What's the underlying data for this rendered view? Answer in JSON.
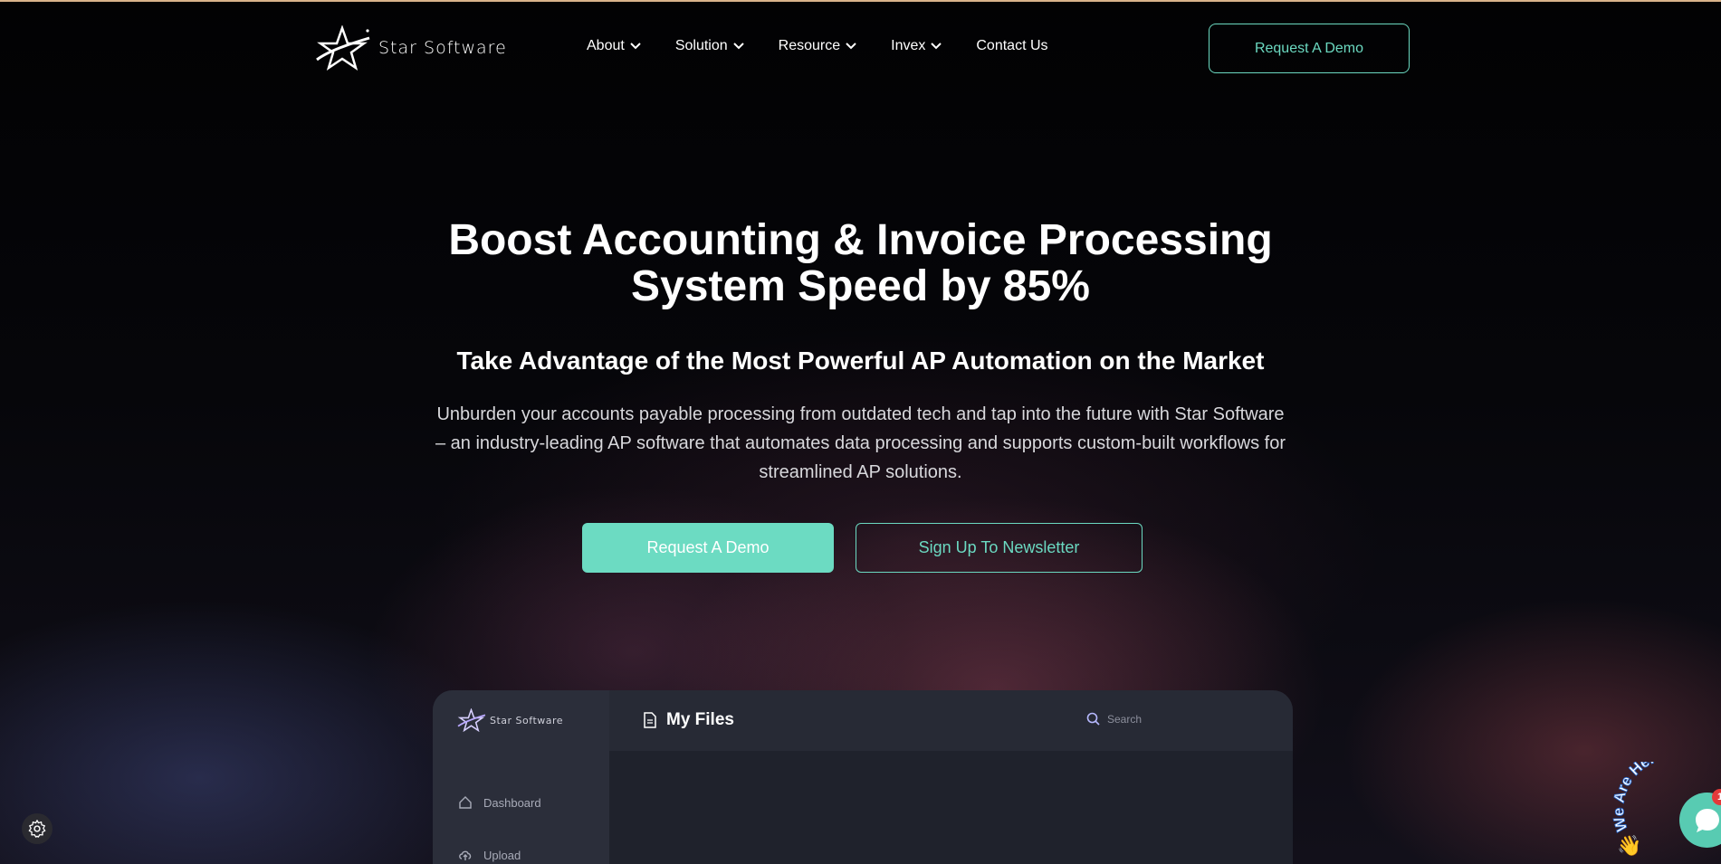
{
  "brand": {
    "name": "Star Software"
  },
  "nav": {
    "items": [
      {
        "label": "About",
        "dropdown": true
      },
      {
        "label": "Solution",
        "dropdown": true
      },
      {
        "label": "Resource",
        "dropdown": true
      },
      {
        "label": "Invex",
        "dropdown": true
      },
      {
        "label": "Contact Us",
        "dropdown": false
      }
    ],
    "cta_label": "Request A Demo"
  },
  "hero": {
    "title_line1": "Boost Accounting & Invoice Processing",
    "title_line2": "System Speed by 85%",
    "subtitle": "Take Advantage of the Most Powerful AP Automation on the Market",
    "description": "Unburden your accounts payable processing from outdated tech and tap into the future with Star Software – an industry-leading AP software that automates data processing and supports custom-built workflows for streamlined AP solutions.",
    "primary_button": "Request A Demo",
    "secondary_button": "Sign Up To Newsletter"
  },
  "mockup": {
    "brand": "Star Software",
    "title": "My Files",
    "search_placeholder": "Search",
    "sidebar": [
      {
        "label": "Dashboard",
        "icon": "home-icon"
      },
      {
        "label": "Upload",
        "icon": "cloud-upload-icon"
      }
    ]
  },
  "chat": {
    "tagline": "We Are Here!",
    "badge_count": "1"
  },
  "colors": {
    "accent": "#6bd9c1",
    "background": "#050507",
    "badge": "#e33a3a"
  }
}
